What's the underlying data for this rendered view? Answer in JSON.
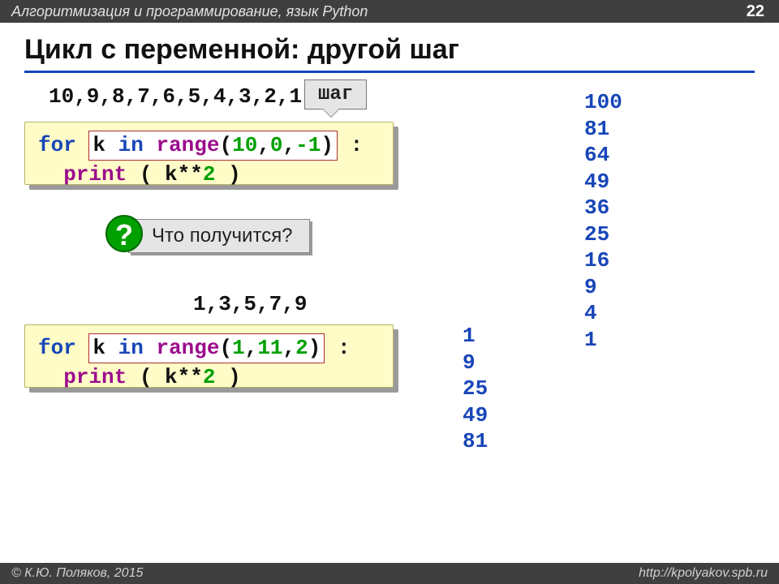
{
  "header": {
    "course": "Алгоритмизация и программирование, язык Python",
    "page": "22"
  },
  "title": "Цикл с переменной: другой шаг",
  "sequence1": "10,9,8,7,6,5,4,3,2,1",
  "callout": "шаг",
  "code1": {
    "for_kw": "for",
    "insert_prefix": "k ",
    "insert_in": "in",
    "insert_range": " range",
    "insert_open": "(",
    "insert_a": "10",
    "insert_c1": ",",
    "insert_b": "0",
    "insert_c2": ",",
    "insert_step": "-1",
    "insert_close": ")",
    "colon": " :",
    "line2_indent": "  ",
    "line2_print": "print",
    "line2_open": " ( k**",
    "line2_num": "2",
    "line2_close": " )"
  },
  "question": {
    "mark": "?",
    "text": "Что получится?"
  },
  "sequence2": "1,3,5,7,9",
  "code2": {
    "for_kw": "for",
    "insert_prefix": "k ",
    "insert_in": "in",
    "insert_range": " range",
    "insert_open": "(",
    "insert_a": "1",
    "insert_c1": ",",
    "insert_b": "11",
    "insert_c2": ",",
    "insert_step": "2",
    "insert_close": ")",
    "colon": " :",
    "line2_indent": "  ",
    "line2_print": "print",
    "line2_open": " ( k**",
    "line2_num": "2",
    "line2_close": " )"
  },
  "output1": [
    "100",
    "81",
    "64",
    "49",
    "36",
    "25",
    "16",
    "9",
    "4",
    "1"
  ],
  "output2": [
    "1",
    "9",
    "25",
    "49",
    "81"
  ],
  "footer": {
    "left": "© К.Ю. Поляков, 2015",
    "right": "http://kpolyakov.spb.ru"
  }
}
